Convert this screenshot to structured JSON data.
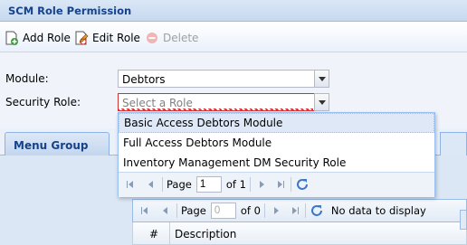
{
  "panel": {
    "title": "SCM Role Permission"
  },
  "toolbar": {
    "add_label": "Add Role",
    "edit_label": "Edit Role",
    "delete_label": "Delete"
  },
  "form": {
    "module_label": "Module:",
    "module_value": "Debtors",
    "role_label": "Security Role:",
    "role_placeholder": "Select a Role"
  },
  "dropdown": {
    "options": [
      "Basic Access Debtors Module",
      "Full Access Debtors Module",
      "Inventory Management DM Security Role"
    ],
    "highlighted_index": 0,
    "paging": {
      "page_label": "Page",
      "page_value": "1",
      "of_label": "of 1"
    }
  },
  "tabs": {
    "menu_group_label": "Menu Group"
  },
  "grid": {
    "paging": {
      "page_label": "Page",
      "page_value": "0",
      "of_label": "of 0",
      "empty_text": "No data to display"
    },
    "columns": [
      "#",
      "Description"
    ]
  },
  "colors": {
    "header_text": "#15428b",
    "invalid_border": "#cc3333",
    "highlight": "#dfe8f6"
  }
}
